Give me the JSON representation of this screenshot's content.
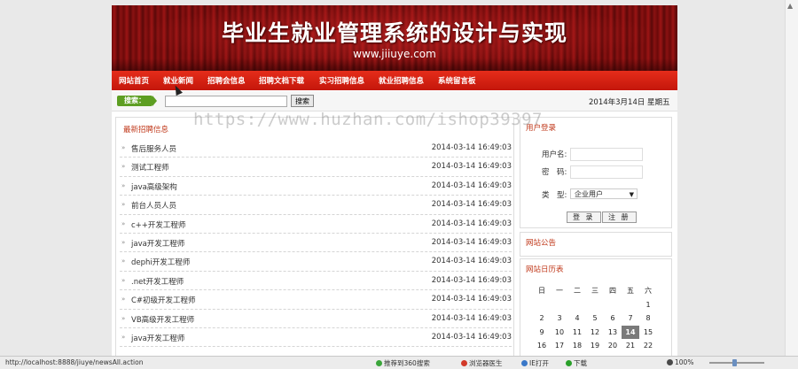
{
  "site": {
    "title": "毕业生就业管理系统的设计与实现",
    "url_text": "www.jiiuye.com"
  },
  "nav": [
    {
      "label": "网站首页"
    },
    {
      "label": "就业新闻"
    },
    {
      "label": "招聘会信息"
    },
    {
      "label": "招聘文档下载"
    },
    {
      "label": "实习招聘信息"
    },
    {
      "label": "就业招聘信息"
    },
    {
      "label": "系统留言板"
    }
  ],
  "search": {
    "label": "搜索：",
    "input_value": "",
    "button_label": "搜索",
    "date_text": "2014年3月14日 星期五"
  },
  "jobs_panel": {
    "title": "最新招聘信息",
    "items": [
      {
        "title": "售后服务人员",
        "time": "2014-03-14 16:49:03"
      },
      {
        "title": "测试工程师",
        "time": "2014-03-14 16:49:03"
      },
      {
        "title": "java高级架构",
        "time": "2014-03-14 16:49:03"
      },
      {
        "title": "前台人员人员",
        "time": "2014-03-14 16:49:03"
      },
      {
        "title": "c++开发工程师",
        "time": "2014-03-14 16:49:03"
      },
      {
        "title": "java开发工程师",
        "time": "2014-03-14 16:49:03"
      },
      {
        "title": "dephi开发工程师",
        "time": "2014-03-14 16:49:03"
      },
      {
        "title": ".net开发工程师",
        "time": "2014-03-14 16:49:03"
      },
      {
        "title": "C#初级开发工程师",
        "time": "2014-03-14 16:49:03"
      },
      {
        "title": "VB高级开发工程师",
        "time": "2014-03-14 16:49:03"
      },
      {
        "title": "java开发工程师",
        "time": "2014-03-14 16:49:03"
      }
    ]
  },
  "login": {
    "title": "用户登录",
    "username_label": "用户名:",
    "password_label": "密　码:",
    "type_label": "类　型:",
    "type_value": "企业用户",
    "login_button": "登 录",
    "register_button": "注 册"
  },
  "notice": {
    "title": "网站公告"
  },
  "calendar": {
    "title": "网站日历表",
    "weekdays": [
      "日",
      "一",
      "二",
      "三",
      "四",
      "五",
      "六"
    ],
    "rows": [
      [
        "",
        "",
        "",
        "",
        "",
        "",
        "1"
      ],
      [
        "2",
        "3",
        "4",
        "5",
        "6",
        "7",
        "8"
      ],
      [
        "9",
        "10",
        "11",
        "12",
        "13",
        "14",
        "15"
      ],
      [
        "16",
        "17",
        "18",
        "19",
        "20",
        "21",
        "22"
      ]
    ],
    "today": "14"
  },
  "watermark": "https://www.huzhan.com/ishop39397",
  "statusbar": {
    "url": "http://localhost:8888/jiuye/newsAll.action",
    "recommend": "推荐到360搜索",
    "doctor": "浏览器医生",
    "ie_open": "IE打开",
    "download": "下载",
    "zoom": "100%"
  },
  "colors": {
    "nav_red": "#d8200f",
    "banner_red": "#8a1010",
    "panel_title": "#c0391b",
    "search_green": "#5d9e22"
  }
}
